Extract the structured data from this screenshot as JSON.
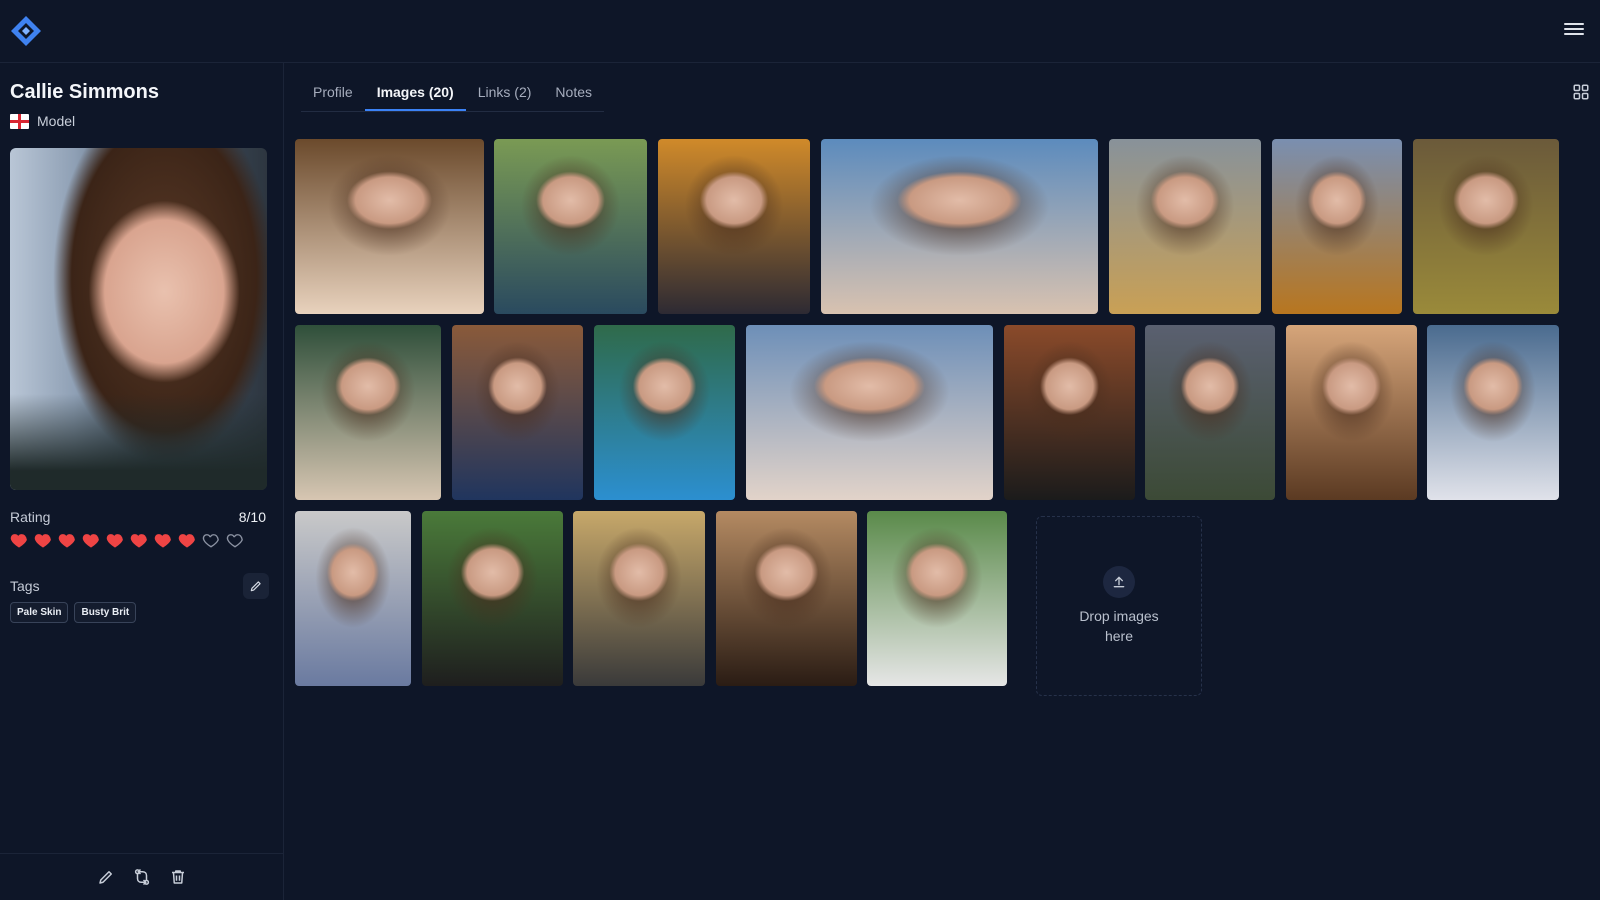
{
  "app": {
    "logo_icon": "diamond-logo-icon",
    "menu_icon": "hamburger-menu-icon"
  },
  "profile": {
    "name": "Callie Simmons",
    "type_label": "Model",
    "flag_icon": "england-flag-icon",
    "portrait_icon": "portrait-photo",
    "rating_label": "Rating",
    "rating_value": "8/10",
    "rating_score": 8,
    "rating_max": 10,
    "tags_label": "Tags",
    "tags": [
      "Pale Skin",
      "Busty Brit"
    ]
  },
  "tabs": [
    {
      "label": "Profile",
      "active": false
    },
    {
      "label": "Images (20)",
      "active": true
    },
    {
      "label": "Links (2)",
      "active": false
    },
    {
      "label": "Notes",
      "active": false
    }
  ],
  "gallery": {
    "image_count": 20,
    "drop_text": "Drop images here"
  },
  "colors": {
    "background": "#0e1628",
    "accent": "#3b82f6",
    "heart_filled": "#ef4444",
    "heart_empty": "#8c93a3"
  }
}
